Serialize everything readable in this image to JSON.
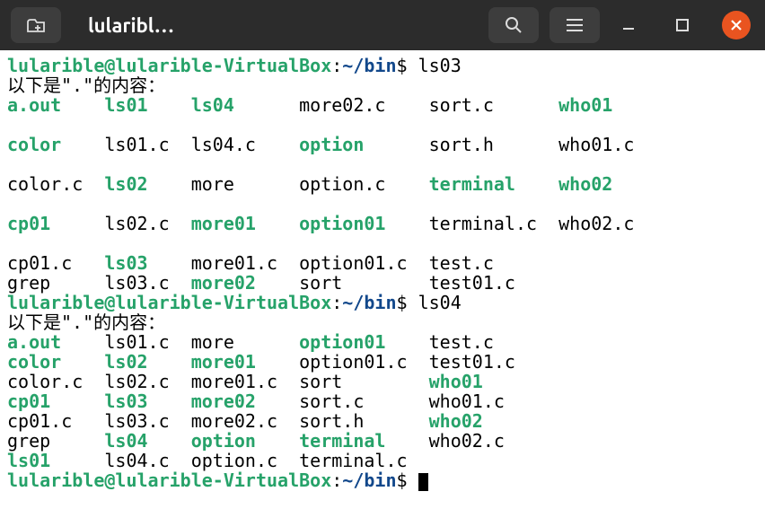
{
  "titlebar": {
    "title": "lularibl…"
  },
  "colors": {
    "green": "#26a269",
    "blue": "#12488b",
    "orange": "#e95420",
    "bg_dark": "#2c2c2c"
  },
  "prompt": {
    "user_host": "lularible@lularible-VirtualBox",
    "path": "~/bin",
    "sep": ":",
    "end": "$"
  },
  "commands": {
    "cmd1": "ls03",
    "cmd2": "ls04"
  },
  "header_text": "以下是\".\"的内容：",
  "ls03": {
    "rows": [
      [
        {
          "t": "a.out",
          "c": "green"
        },
        {
          "t": "ls01",
          "c": "green"
        },
        {
          "t": "ls04",
          "c": "green"
        },
        {
          "t": "more02.c",
          "c": "black"
        },
        {
          "t": "sort.c",
          "c": "black"
        },
        {
          "t": "who01",
          "c": "green"
        }
      ],
      [
        {
          "t": "color",
          "c": "green"
        },
        {
          "t": "ls01.c",
          "c": "black"
        },
        {
          "t": "ls04.c",
          "c": "black"
        },
        {
          "t": "option",
          "c": "green"
        },
        {
          "t": "sort.h",
          "c": "black"
        },
        {
          "t": "who01.c",
          "c": "black"
        }
      ],
      [
        {
          "t": "color.c",
          "c": "black"
        },
        {
          "t": "ls02",
          "c": "green"
        },
        {
          "t": "more",
          "c": "black"
        },
        {
          "t": "option.c",
          "c": "black"
        },
        {
          "t": "terminal",
          "c": "green"
        },
        {
          "t": "who02",
          "c": "green"
        }
      ],
      [
        {
          "t": "cp01",
          "c": "green"
        },
        {
          "t": "ls02.c",
          "c": "black"
        },
        {
          "t": "more01",
          "c": "green"
        },
        {
          "t": "option01",
          "c": "green"
        },
        {
          "t": "terminal.c",
          "c": "black"
        },
        {
          "t": "who02.c",
          "c": "black"
        }
      ],
      [
        {
          "t": "cp01.c",
          "c": "black"
        },
        {
          "t": "ls03",
          "c": "green"
        },
        {
          "t": "more01.c",
          "c": "black"
        },
        {
          "t": "option01.c",
          "c": "black"
        },
        {
          "t": "test.c",
          "c": "black"
        },
        {
          "t": "",
          "c": "black"
        }
      ],
      [
        {
          "t": "grep",
          "c": "black"
        },
        {
          "t": "ls03.c",
          "c": "black"
        },
        {
          "t": "more02",
          "c": "green"
        },
        {
          "t": "sort",
          "c": "black"
        },
        {
          "t": "test01.c",
          "c": "black"
        },
        {
          "t": "",
          "c": "black"
        }
      ]
    ],
    "widths": [
      9,
      8,
      10,
      12,
      12,
      8
    ],
    "blank_after": [
      0,
      1,
      2,
      3
    ]
  },
  "ls04": {
    "rows": [
      [
        {
          "t": "a.out",
          "c": "green"
        },
        {
          "t": "ls01.c",
          "c": "black"
        },
        {
          "t": "more",
          "c": "black"
        },
        {
          "t": "option01",
          "c": "green"
        },
        {
          "t": "test.c",
          "c": "black"
        }
      ],
      [
        {
          "t": "color",
          "c": "green"
        },
        {
          "t": "ls02",
          "c": "green"
        },
        {
          "t": "more01",
          "c": "green"
        },
        {
          "t": "option01.c",
          "c": "black"
        },
        {
          "t": "test01.c",
          "c": "black"
        }
      ],
      [
        {
          "t": "color.c",
          "c": "black"
        },
        {
          "t": "ls02.c",
          "c": "black"
        },
        {
          "t": "more01.c",
          "c": "black"
        },
        {
          "t": "sort",
          "c": "black"
        },
        {
          "t": "who01",
          "c": "green"
        }
      ],
      [
        {
          "t": "cp01",
          "c": "green"
        },
        {
          "t": "ls03",
          "c": "green"
        },
        {
          "t": "more02",
          "c": "green"
        },
        {
          "t": "sort.c",
          "c": "black"
        },
        {
          "t": "who01.c",
          "c": "black"
        }
      ],
      [
        {
          "t": "cp01.c",
          "c": "black"
        },
        {
          "t": "ls03.c",
          "c": "black"
        },
        {
          "t": "more02.c",
          "c": "black"
        },
        {
          "t": "sort.h",
          "c": "black"
        },
        {
          "t": "who02",
          "c": "green"
        }
      ],
      [
        {
          "t": "grep",
          "c": "black"
        },
        {
          "t": "ls04",
          "c": "green"
        },
        {
          "t": "option",
          "c": "green"
        },
        {
          "t": "terminal",
          "c": "green"
        },
        {
          "t": "who02.c",
          "c": "black"
        }
      ],
      [
        {
          "t": "ls01",
          "c": "green"
        },
        {
          "t": "ls04.c",
          "c": "black"
        },
        {
          "t": "option.c",
          "c": "black"
        },
        {
          "t": "terminal.c",
          "c": "black"
        },
        {
          "t": "",
          "c": "black"
        }
      ]
    ],
    "widths": [
      9,
      8,
      10,
      12,
      10
    ]
  }
}
